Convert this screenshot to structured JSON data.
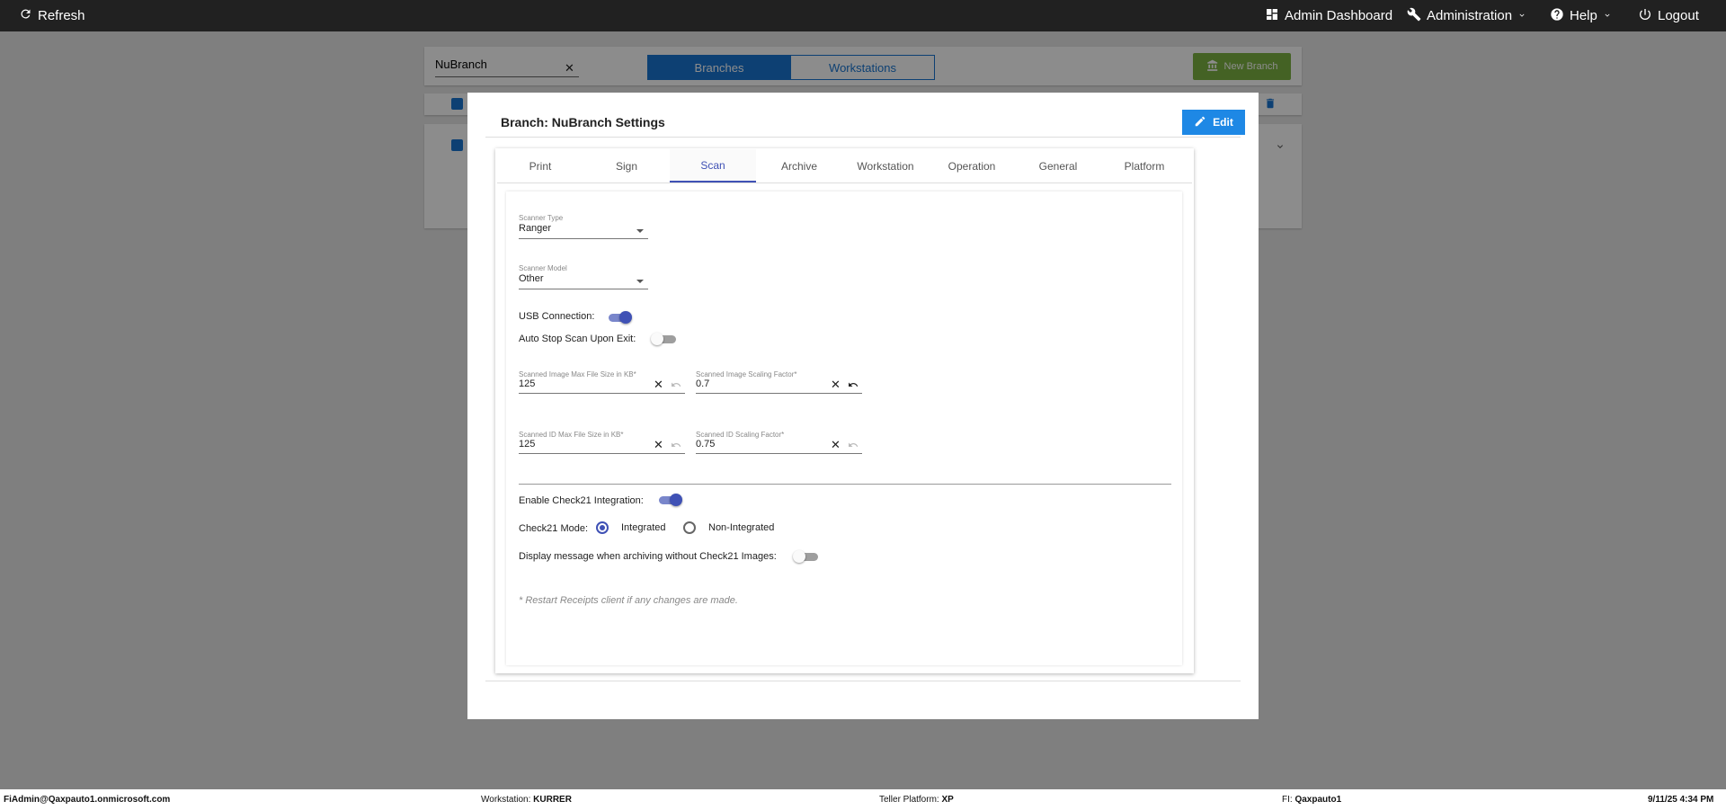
{
  "topbar": {
    "refresh": "Refresh",
    "admin_dashboard": "Admin Dashboard",
    "administration": "Administration",
    "help": "Help",
    "logout": "Logout"
  },
  "background": {
    "search_value": "NuBranch",
    "seg_branches": "Branches",
    "seg_workstations": "Workstations",
    "new_branch": "New Branch"
  },
  "modal": {
    "title": "Branch: NuBranch Settings",
    "edit": "Edit",
    "tabs": [
      "Print",
      "Sign",
      "Scan",
      "Archive",
      "Workstation",
      "Operation",
      "General",
      "Platform"
    ],
    "active_tab": "Scan"
  },
  "scan": {
    "scanner_type_label": "Scanner Type",
    "scanner_type_value": "Ranger",
    "scanner_model_label": "Scanner Model",
    "scanner_model_value": "Other",
    "usb_label": "USB Connection:",
    "usb_on": true,
    "auto_stop_label": "Auto Stop Scan Upon Exit:",
    "auto_stop_on": false,
    "img_max_label": "Scanned Image Max File Size in KB*",
    "img_max_value": "125",
    "img_scale_label": "Scanned Image Scaling Factor*",
    "img_scale_value": "0.7",
    "id_max_label": "Scanned ID Max File Size in KB*",
    "id_max_value": "125",
    "id_scale_label": "Scanned ID Scaling Factor*",
    "id_scale_value": "0.75",
    "check21_label": "Enable Check21 Integration:",
    "check21_on": true,
    "mode_label": "Check21 Mode:",
    "mode_integrated": "Integrated",
    "mode_non_integrated": "Non-Integrated",
    "mode_selected": "Integrated",
    "display_msg_label": "Display message when archiving without Check21 Images:",
    "display_msg_on": false,
    "note": "* Restart Receipts client if any changes are made."
  },
  "footer": {
    "user": "FiAdmin@Qaxpauto1.onmicrosoft.com",
    "workstation_label": "Workstation:",
    "workstation_value": "KURRER",
    "teller_label": "Teller Platform:",
    "teller_value": "XP",
    "fi_label": "FI:",
    "fi_value": "Qaxpauto1",
    "datetime": "9/11/25 4:34 PM"
  },
  "colors": {
    "topbar": "#212121",
    "primary": "#1976d2",
    "indigo": "#3f51b5",
    "new_branch": "#7cb342"
  }
}
